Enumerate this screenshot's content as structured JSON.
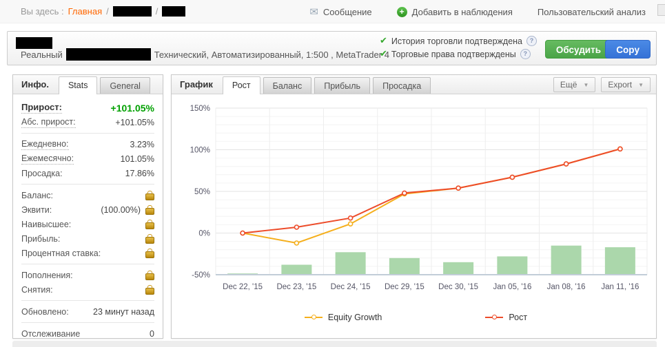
{
  "breadcrumb": {
    "label": "Вы здесь :",
    "home": "Главная",
    "sep": "/"
  },
  "topbar": {
    "message": "Сообщение",
    "add_watch": "Добавить в наблюдения",
    "custom_analysis": "Пользовательский анализ"
  },
  "icons": {
    "message_glyph": "✉",
    "add_glyph": "+",
    "check_glyph": "✔",
    "question_glyph": "?",
    "dropdown_glyph": "▼"
  },
  "account": {
    "type": "Реальный",
    "details": "Технический, Автоматизированный, 1:500 , MetaTrader 4",
    "verify1": "История торговли подтверждена",
    "verify2": "Торговые права подтверждены",
    "discuss_label": "Обсудить",
    "copy_label": "Copy"
  },
  "sidebar": {
    "title": "Инфо.",
    "tabs": [
      {
        "label": "Stats"
      },
      {
        "label": "General"
      }
    ],
    "groups": [
      {
        "rows": [
          {
            "label": "Прирост:",
            "value": "+101.05%"
          },
          {
            "label": "Абс. прирост:",
            "value": "+101.05%"
          }
        ]
      },
      {
        "rows": [
          {
            "label": "Ежедневно:",
            "value": "3.23%"
          },
          {
            "label": "Ежемесячно:",
            "value": "101.05%"
          },
          {
            "label": "Просадка:",
            "value": "17.86%"
          }
        ]
      },
      {
        "rows": [
          {
            "label": "Баланс:",
            "value": ""
          },
          {
            "label": "Эквити:",
            "value": "(100.00%)"
          },
          {
            "label": "Наивысшее:",
            "value": ""
          },
          {
            "label": "Прибыль:",
            "value": ""
          },
          {
            "label": "Процентная ставка:",
            "value": ""
          }
        ]
      },
      {
        "rows": [
          {
            "label": "Пополнения:",
            "value": ""
          },
          {
            "label": "Снятия:",
            "value": ""
          }
        ]
      },
      {
        "rows": [
          {
            "label": "Обновлено:",
            "value": "23 минут назад"
          }
        ]
      },
      {
        "rows": [
          {
            "label": "Отслеживание",
            "value": "0"
          }
        ]
      }
    ]
  },
  "chart": {
    "title": "График",
    "tabs": [
      {
        "label": "Рост",
        "active": true
      },
      {
        "label": "Баланс",
        "active": false
      },
      {
        "label": "Прибыль",
        "active": false
      },
      {
        "label": "Просадка",
        "active": false
      }
    ],
    "more_label": "Ещё",
    "export_label": "Export"
  },
  "chart_data": {
    "type": "line",
    "categories": [
      "Dec 22, '15",
      "Dec 23, '15",
      "Dec 24, '15",
      "Dec 29, '15",
      "Dec 30, '15",
      "Jan 05, '16",
      "Jan 08, '16",
      "Jan 11, '16"
    ],
    "series": [
      {
        "name": "Equity Growth",
        "type": "line",
        "color": "#f5af1c",
        "values": [
          0,
          -12,
          11,
          47,
          54,
          67,
          83,
          101
        ]
      },
      {
        "name": "Рост",
        "type": "line",
        "color": "#ed4c2a",
        "values": [
          0,
          7,
          18,
          48,
          54,
          67,
          83,
          101
        ]
      },
      {
        "name": "volume-bars",
        "type": "bar",
        "color": "#abd7ab",
        "values": [
          -48.5,
          -38,
          -23,
          -30,
          -35,
          -28,
          -15,
          -17
        ]
      }
    ],
    "ylabel": "",
    "xlabel": "",
    "ylim": [
      -50,
      150
    ],
    "yticks": [
      150,
      100,
      50,
      0,
      -50
    ],
    "ytick_suffix": "%",
    "minor_grid_step": 10,
    "grid": true,
    "legend_position": "bottom",
    "bar_baseline": -50
  }
}
